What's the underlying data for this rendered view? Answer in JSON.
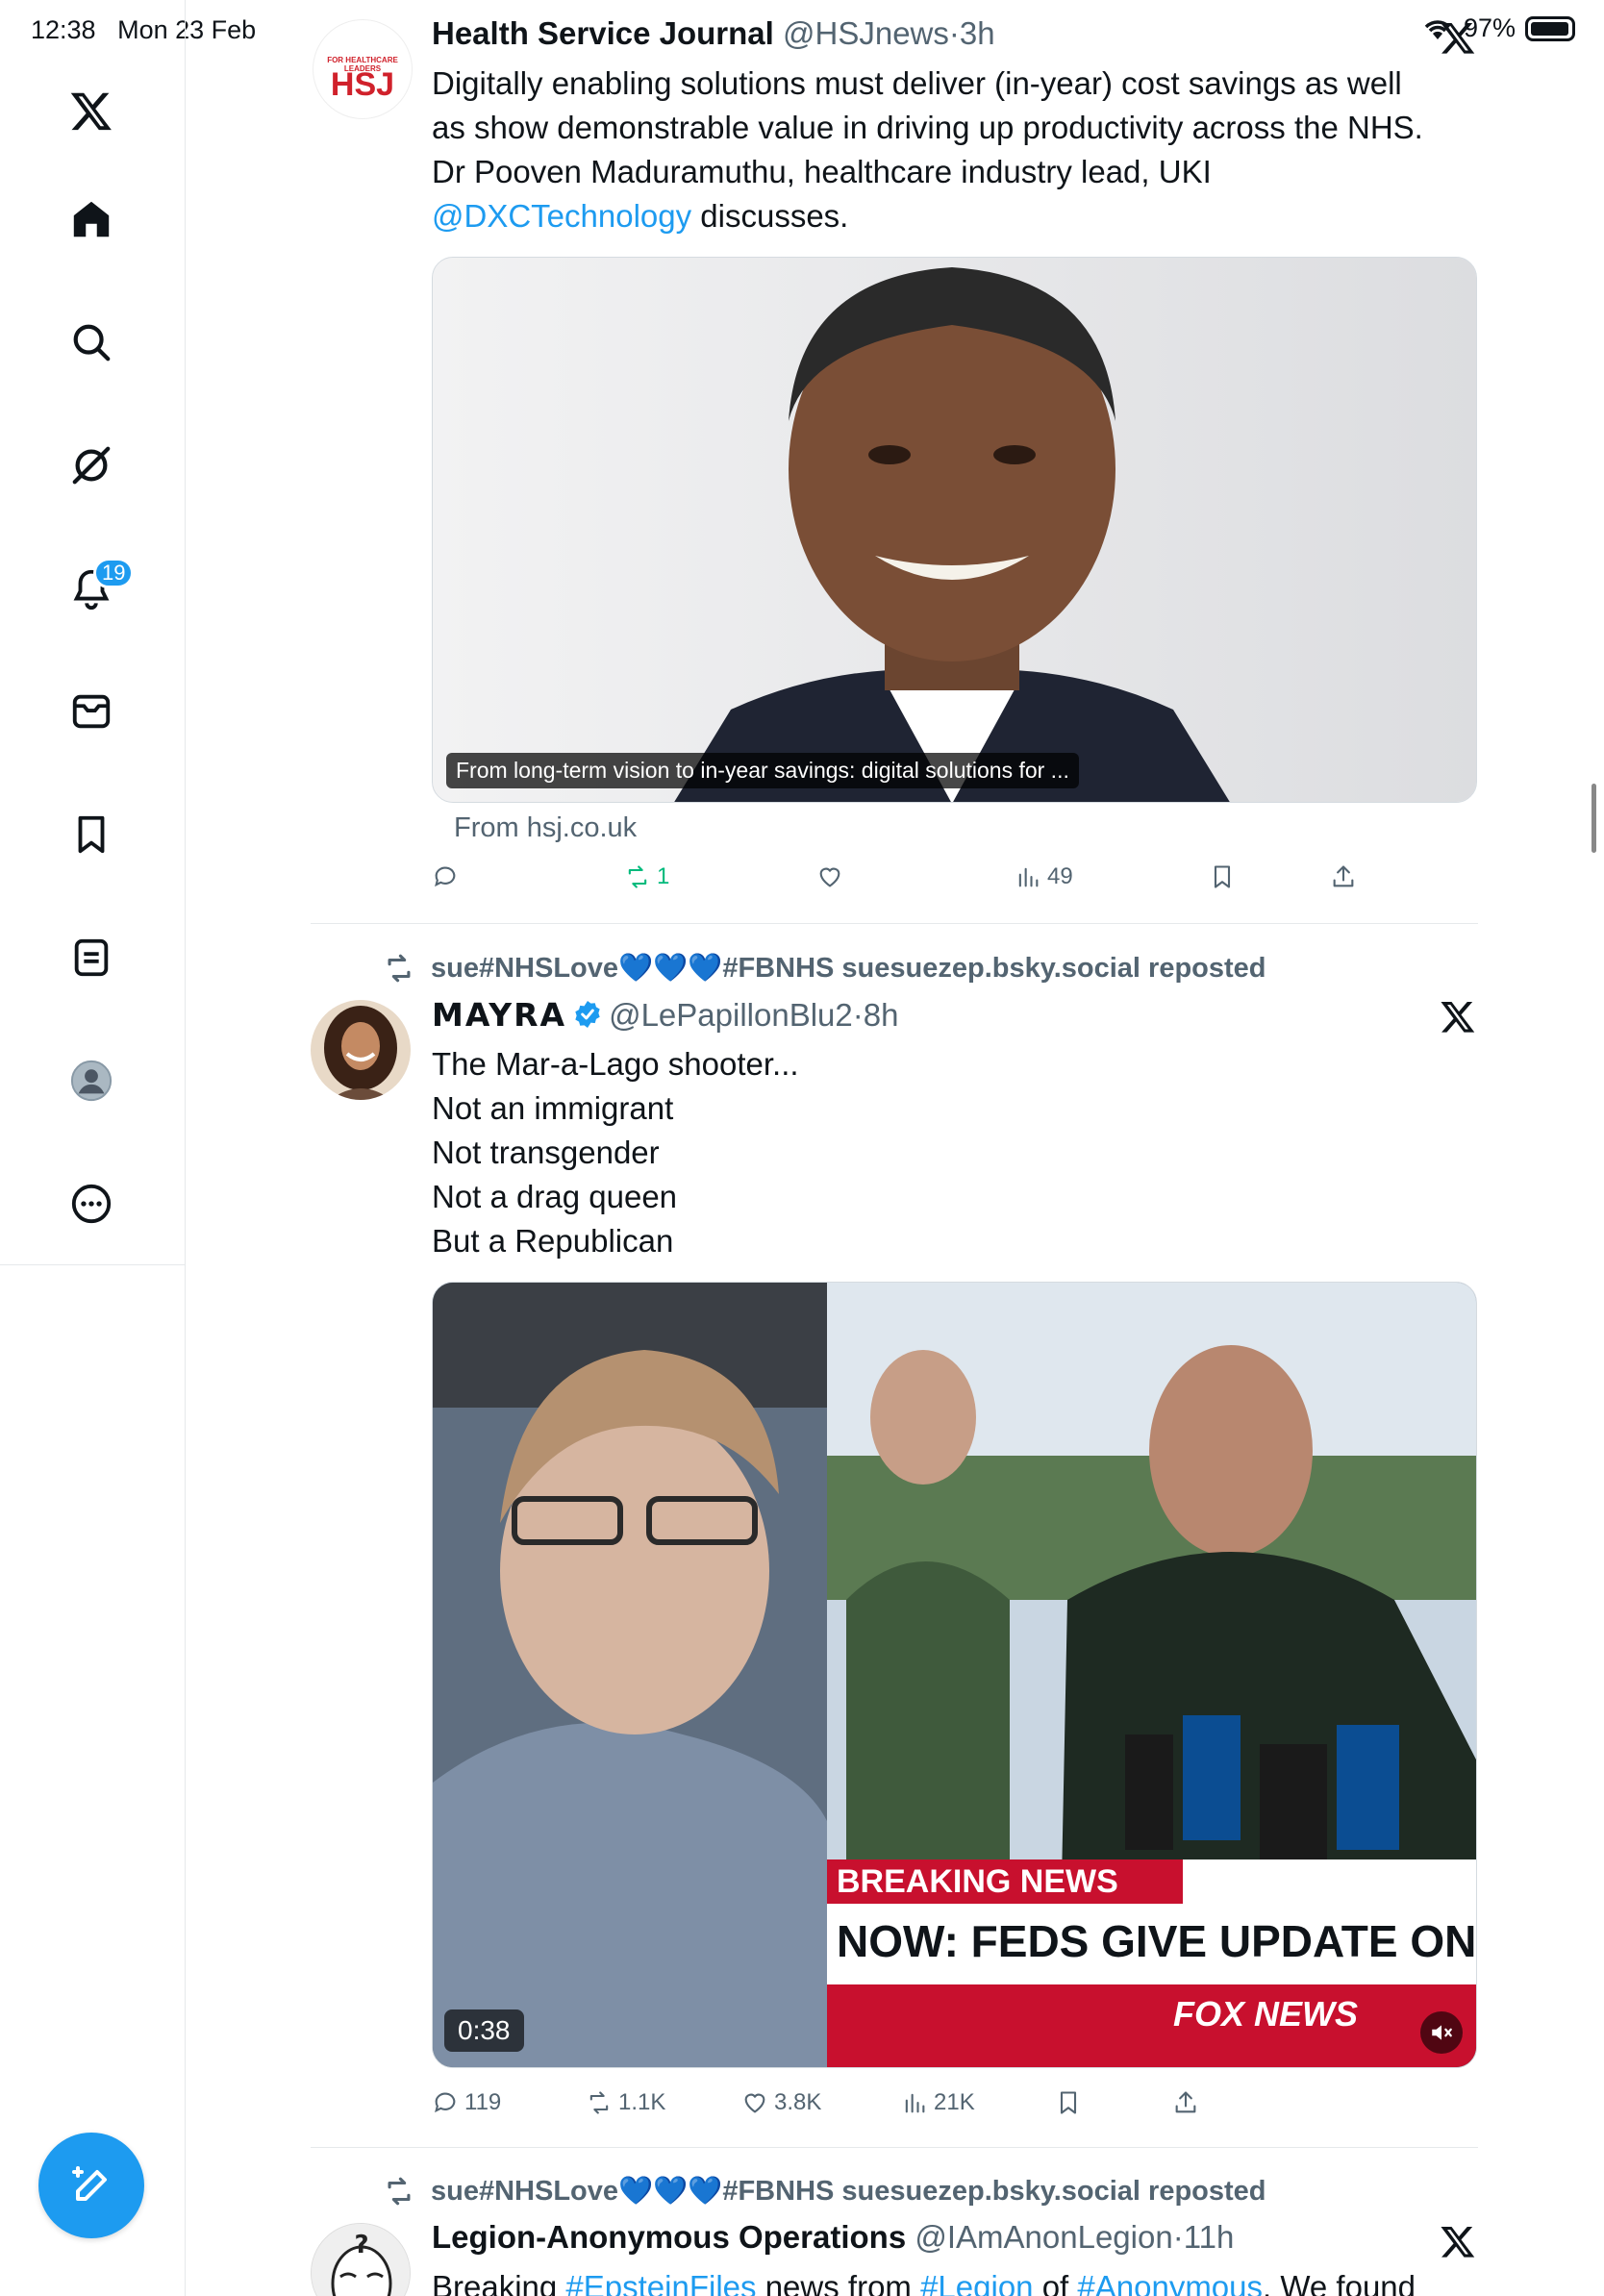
{
  "status_bar": {
    "time": "12:38",
    "date": "Mon 23 Feb",
    "battery": "97%",
    "battery_level": 0.97
  },
  "sidebar": {
    "items": [
      {
        "name": "x-logo-icon"
      },
      {
        "name": "home-icon"
      },
      {
        "name": "search-icon"
      },
      {
        "name": "grok-icon"
      },
      {
        "name": "notifications-icon",
        "badge": "19"
      },
      {
        "name": "messages-icon"
      },
      {
        "name": "bookmarks-icon"
      },
      {
        "name": "lists-icon"
      },
      {
        "name": "profile-icon"
      },
      {
        "name": "more-icon"
      }
    ],
    "compose": {
      "name": "compose-icon"
    }
  },
  "posts": [
    {
      "author": "Health Service Journal",
      "handle": "@HSJnews",
      "time": "3h",
      "avatar_text": "HSJ",
      "avatar_subtext": "FOR HEALTHCARE LEADERS",
      "text_lines": [
        "Digitally enabling solutions must deliver (in-year) cost savings as well",
        "as show demonstrable value in driving up productivity across the NHS.",
        "Dr Pooven Maduramuthu, healthcare industry lead, UKI"
      ],
      "mention": "@DXCTechnology",
      "mention_tail": " discusses.",
      "card_caption": "From long-term vision to in-year savings: digital solutions for ...",
      "card_source": "From hsj.co.uk",
      "stats": {
        "replies": "",
        "reposts": "1",
        "likes": "",
        "views": "49"
      }
    },
    {
      "reposted_by": "sue#NHSLove💙💙💙#FBNHS suesuezep.bsky.social reposted",
      "author": "MAYRA",
      "handle": "@LePapillonBlu2",
      "time": "8h",
      "text_lines": [
        "The Mar-a-Lago shooter...",
        "Not an immigrant",
        "Not transgender",
        "Not a drag queen",
        "But a Republican"
      ],
      "video": {
        "duration": "0:38",
        "banner_top": "BREAKING NEWS",
        "banner_main": "NOW: FEDS GIVE UPDATE ON SHOO",
        "network": "FOX NEWS"
      },
      "stats": {
        "replies": "119",
        "reposts": "1.1K",
        "likes": "3.8K",
        "views": "21K"
      }
    },
    {
      "reposted_by": "sue#NHSLove💙💙💙#FBNHS suesuezep.bsky.social reposted",
      "author": "Legion-Anonymous Operations",
      "handle": "@IAmAnonLegion",
      "time": "11h",
      "text_prefix": "Breaking ",
      "tag1": "#EpsteinFiles",
      "text_mid1": " news from ",
      "tag2": "#Legion",
      "text_mid2": " of ",
      "tag3": "#Anonymous",
      "text_tail": ". We found"
    }
  ],
  "colors": {
    "accent": "#1d9bf0",
    "retweet": "#00ba7c",
    "muted": "#536471",
    "text": "#0f1419",
    "hsj_red": "#d0212b"
  }
}
